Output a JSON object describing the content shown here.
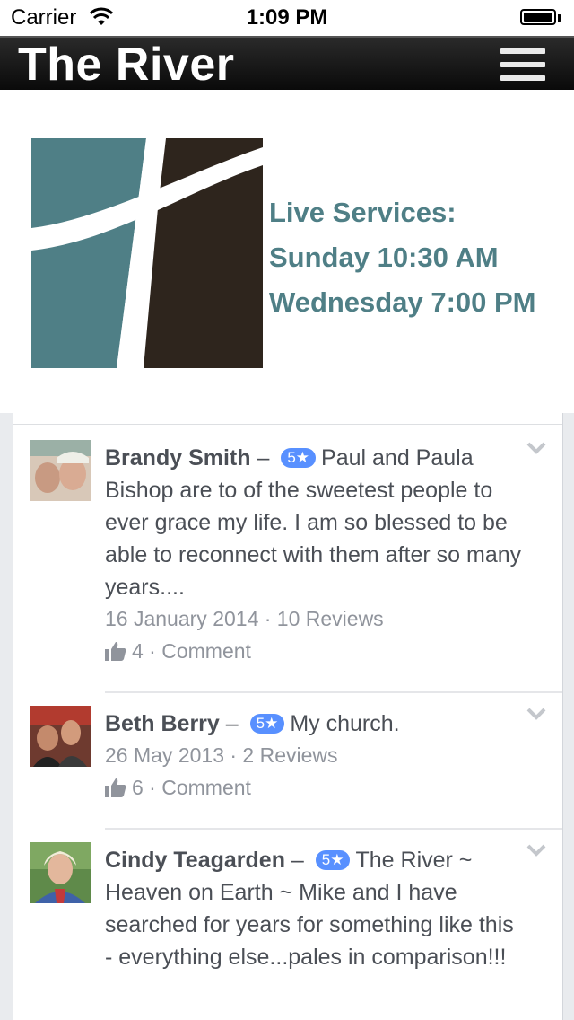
{
  "status_bar": {
    "carrier": "Carrier",
    "time": "1:09 PM"
  },
  "nav": {
    "title": "The River"
  },
  "hero": {
    "services": [
      "Live Services:",
      "Sunday 10:30 AM",
      "Wednesday 7:00 PM"
    ],
    "colors": {
      "teal": "#4f7f86",
      "brown": "#2e251d"
    }
  },
  "reviews": [
    {
      "name": "Brandy Smith",
      "dash": "–",
      "rating": "5★",
      "text": "Paul and Paula Bishop are to of the sweetest people to ever grace my life. I am so blessed to be able to reconnect with them after so many years....",
      "date": "16 January 2014 · 10 Reviews",
      "likes": "4",
      "sep": " · ",
      "comment": "Comment"
    },
    {
      "name": "Beth Berry",
      "dash": "–",
      "rating": "5★",
      "text": "My church.",
      "date": "26 May 2013 · 2 Reviews",
      "likes": "6",
      "sep": " · ",
      "comment": "Comment"
    },
    {
      "name": "Cindy Teagarden",
      "dash": "–",
      "rating": "5★",
      "text": "The River ~ Heaven on Earth ~ Mike and I have searched for years for something like this - everything else...pales in comparison!!!",
      "date": "",
      "likes": "",
      "sep": "",
      "comment": ""
    }
  ]
}
